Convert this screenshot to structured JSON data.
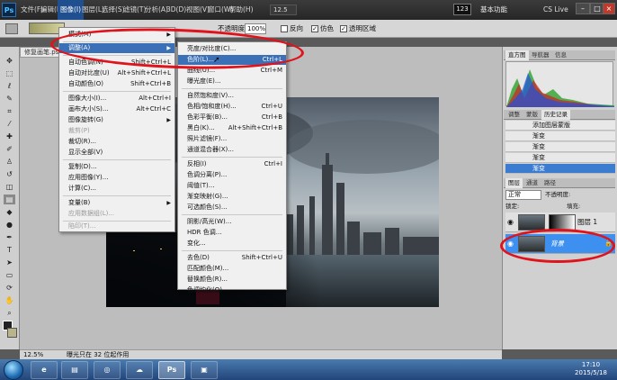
{
  "app": {
    "logo": "Ps",
    "menus": [
      "文件(F)",
      "编辑(E)",
      "图像(I)",
      "图层(L)",
      "选择(S)",
      "滤镜(T)",
      "分析(A)",
      "3D(D)",
      "视图(V)",
      "窗口(W)",
      "帮助(H)"
    ],
    "zoom_field": "12.5",
    "badge": "123",
    "workspace": "基本功能",
    "cslive": "CS Live"
  },
  "options": {
    "mode_label": "不透明度:",
    "opacity": "100%",
    "reverse": "反向",
    "dither": "仿色",
    "transparency": "透明区域"
  },
  "doc": {
    "tab": "修复画笔.psd",
    "zoom": "12.5%",
    "status": "曝光只在 32 位起作用"
  },
  "image_menu": {
    "items": [
      {
        "label": "模式(M)",
        "arrow": "▶"
      },
      {
        "label": "调整(A)",
        "arrow": "▶"
      },
      {
        "label": "自动色调(N)",
        "shortcut": "Shift+Ctrl+L"
      },
      {
        "label": "自动对比度(U)",
        "shortcut": "Alt+Shift+Ctrl+L"
      },
      {
        "label": "自动颜色(O)",
        "shortcut": "Shift+Ctrl+B"
      },
      {
        "label": "图像大小(I)...",
        "shortcut": "Alt+Ctrl+I"
      },
      {
        "label": "画布大小(S)...",
        "shortcut": "Alt+Ctrl+C"
      },
      {
        "label": "图像旋转(G)",
        "arrow": "▶"
      },
      {
        "label": "裁剪(P)"
      },
      {
        "label": "裁切(R)..."
      },
      {
        "label": "显示全部(V)"
      },
      {
        "label": "复制(D)..."
      },
      {
        "label": "应用图像(Y)..."
      },
      {
        "label": "计算(C)..."
      },
      {
        "label": "变量(B)",
        "arrow": "▶"
      },
      {
        "label": "应用数据组(L)..."
      },
      {
        "label": "陷印(T)..."
      }
    ]
  },
  "adjust_menu": {
    "items": [
      {
        "label": "亮度/对比度(C)..."
      },
      {
        "label": "色阶(L)...",
        "shortcut": "Ctrl+L"
      },
      {
        "label": "曲线(U)...",
        "shortcut": "Ctrl+M"
      },
      {
        "label": "曝光度(E)..."
      },
      {
        "label": "自然饱和度(V)..."
      },
      {
        "label": "色相/饱和度(H)...",
        "shortcut": "Ctrl+U"
      },
      {
        "label": "色彩平衡(B)...",
        "shortcut": "Ctrl+B"
      },
      {
        "label": "黑白(K)...",
        "shortcut": "Alt+Shift+Ctrl+B"
      },
      {
        "label": "照片滤镜(F)..."
      },
      {
        "label": "通道混合器(X)..."
      },
      {
        "label": "反相(I)",
        "shortcut": "Ctrl+I"
      },
      {
        "label": "色调分离(P)..."
      },
      {
        "label": "阈值(T)..."
      },
      {
        "label": "渐变映射(G)..."
      },
      {
        "label": "可选颜色(S)..."
      },
      {
        "label": "阴影/高光(W)..."
      },
      {
        "label": "HDR 色调..."
      },
      {
        "label": "变化..."
      },
      {
        "label": "去色(D)",
        "shortcut": "Shift+Ctrl+U"
      },
      {
        "label": "匹配颜色(M)..."
      },
      {
        "label": "替换颜色(R)..."
      },
      {
        "label": "色调均化(Q)"
      }
    ]
  },
  "panels": {
    "top_tabs": [
      "直方图",
      "导航器",
      "信息"
    ],
    "mid_tabs": [
      "调整",
      "蒙版",
      "历史记录"
    ],
    "history": [
      "添加图层蒙版",
      "渐变",
      "渐变",
      "渐变",
      "渐变"
    ],
    "layer_tabs": [
      "图层",
      "通道",
      "路径"
    ],
    "blend_mode": "正常",
    "opacity_label": "不透明度:",
    "lock_label": "锁定:",
    "fill_label": "填充:",
    "layers": [
      "图层 1",
      "背景"
    ]
  },
  "taskbar": {
    "ps_label": "Ps",
    "time": "17:10",
    "date": "2015/5/18"
  },
  "colors": {
    "accent": "#3b6fb6",
    "annotation": "#e0121b"
  }
}
